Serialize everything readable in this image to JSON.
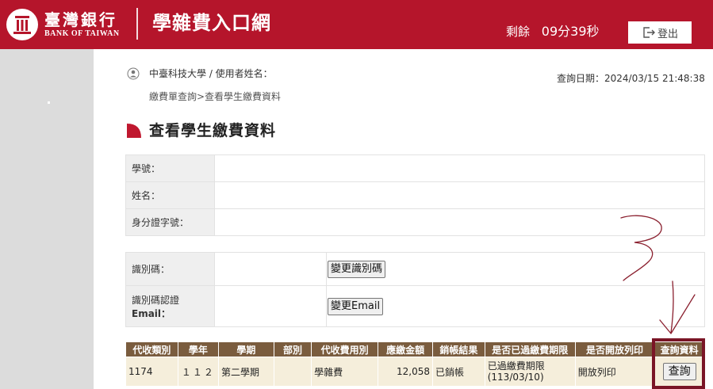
{
  "header": {
    "bank_name_cn": "臺灣銀行",
    "bank_name_en": "BANK OF TAIWAN",
    "site_title": "學雜費入口網",
    "countdown_label": "剩餘",
    "countdown_value": "09分39秒",
    "logout_label": "登出"
  },
  "info": {
    "user_line": "中臺科技大學 / 使用者姓名：",
    "query_date": "查詢日期：2024/03/15 21:48:38",
    "breadcrumb": "繳費單查詢>查看學生繳費資料",
    "page_title": "查看學生繳費資料"
  },
  "student": {
    "student_id_label": "學號：",
    "student_id_value": "",
    "name_label": "姓名：",
    "name_value": "",
    "id_number_label": "身分證字號：",
    "id_number_value": ""
  },
  "identification": {
    "code_label": "識別碼：",
    "code_value": "",
    "change_code_button": "變更識別碼",
    "email_label_line1": "識別碼認證",
    "email_label_line2": "Email：",
    "email_value": "",
    "change_email_button": "變更Email"
  },
  "fee_table": {
    "headers": [
      "代收類別",
      "學年",
      "學期",
      "部別",
      "代收費用別",
      "應繳金額",
      "銷帳結果",
      "是否已過繳費期限",
      "是否開放列印",
      "查詢資料"
    ],
    "rows": [
      {
        "category": "1174",
        "year": "１１２",
        "term": "第二學期",
        "division": "",
        "fee_type": "學雜費",
        "amount": "12,058",
        "settlement": "已銷帳",
        "deadline_line1": "已過繳費期限",
        "deadline_line2": "(113/03/10)",
        "print_status": "開放列印",
        "query_button": "查詢"
      }
    ]
  },
  "colors": {
    "header_bg": "#b5152b",
    "table_header_bg": "#7a5c3e",
    "table_row_bg": "#f5eedb",
    "label_bg": "#efefef",
    "annotation_color": "#8a1f2e"
  }
}
